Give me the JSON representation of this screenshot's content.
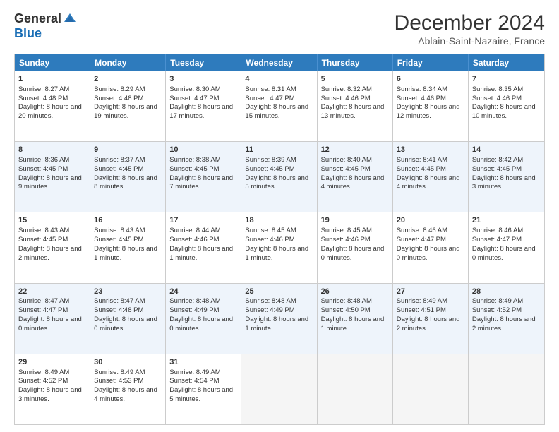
{
  "header": {
    "logo_general": "General",
    "logo_blue": "Blue",
    "month_title": "December 2024",
    "location": "Ablain-Saint-Nazaire, France"
  },
  "weekdays": [
    "Sunday",
    "Monday",
    "Tuesday",
    "Wednesday",
    "Thursday",
    "Friday",
    "Saturday"
  ],
  "rows": [
    {
      "alt": false,
      "cells": [
        {
          "day": "1",
          "info": "Sunrise: 8:27 AM\nSunset: 4:48 PM\nDaylight: 8 hours and 20 minutes."
        },
        {
          "day": "2",
          "info": "Sunrise: 8:29 AM\nSunset: 4:48 PM\nDaylight: 8 hours and 19 minutes."
        },
        {
          "day": "3",
          "info": "Sunrise: 8:30 AM\nSunset: 4:47 PM\nDaylight: 8 hours and 17 minutes."
        },
        {
          "day": "4",
          "info": "Sunrise: 8:31 AM\nSunset: 4:47 PM\nDaylight: 8 hours and 15 minutes."
        },
        {
          "day": "5",
          "info": "Sunrise: 8:32 AM\nSunset: 4:46 PM\nDaylight: 8 hours and 13 minutes."
        },
        {
          "day": "6",
          "info": "Sunrise: 8:34 AM\nSunset: 4:46 PM\nDaylight: 8 hours and 12 minutes."
        },
        {
          "day": "7",
          "info": "Sunrise: 8:35 AM\nSunset: 4:46 PM\nDaylight: 8 hours and 10 minutes."
        }
      ]
    },
    {
      "alt": true,
      "cells": [
        {
          "day": "8",
          "info": "Sunrise: 8:36 AM\nSunset: 4:45 PM\nDaylight: 8 hours and 9 minutes."
        },
        {
          "day": "9",
          "info": "Sunrise: 8:37 AM\nSunset: 4:45 PM\nDaylight: 8 hours and 8 minutes."
        },
        {
          "day": "10",
          "info": "Sunrise: 8:38 AM\nSunset: 4:45 PM\nDaylight: 8 hours and 7 minutes."
        },
        {
          "day": "11",
          "info": "Sunrise: 8:39 AM\nSunset: 4:45 PM\nDaylight: 8 hours and 5 minutes."
        },
        {
          "day": "12",
          "info": "Sunrise: 8:40 AM\nSunset: 4:45 PM\nDaylight: 8 hours and 4 minutes."
        },
        {
          "day": "13",
          "info": "Sunrise: 8:41 AM\nSunset: 4:45 PM\nDaylight: 8 hours and 4 minutes."
        },
        {
          "day": "14",
          "info": "Sunrise: 8:42 AM\nSunset: 4:45 PM\nDaylight: 8 hours and 3 minutes."
        }
      ]
    },
    {
      "alt": false,
      "cells": [
        {
          "day": "15",
          "info": "Sunrise: 8:43 AM\nSunset: 4:45 PM\nDaylight: 8 hours and 2 minutes."
        },
        {
          "day": "16",
          "info": "Sunrise: 8:43 AM\nSunset: 4:45 PM\nDaylight: 8 hours and 1 minute."
        },
        {
          "day": "17",
          "info": "Sunrise: 8:44 AM\nSunset: 4:46 PM\nDaylight: 8 hours and 1 minute."
        },
        {
          "day": "18",
          "info": "Sunrise: 8:45 AM\nSunset: 4:46 PM\nDaylight: 8 hours and 1 minute."
        },
        {
          "day": "19",
          "info": "Sunrise: 8:45 AM\nSunset: 4:46 PM\nDaylight: 8 hours and 0 minutes."
        },
        {
          "day": "20",
          "info": "Sunrise: 8:46 AM\nSunset: 4:47 PM\nDaylight: 8 hours and 0 minutes."
        },
        {
          "day": "21",
          "info": "Sunrise: 8:46 AM\nSunset: 4:47 PM\nDaylight: 8 hours and 0 minutes."
        }
      ]
    },
    {
      "alt": true,
      "cells": [
        {
          "day": "22",
          "info": "Sunrise: 8:47 AM\nSunset: 4:47 PM\nDaylight: 8 hours and 0 minutes."
        },
        {
          "day": "23",
          "info": "Sunrise: 8:47 AM\nSunset: 4:48 PM\nDaylight: 8 hours and 0 minutes."
        },
        {
          "day": "24",
          "info": "Sunrise: 8:48 AM\nSunset: 4:49 PM\nDaylight: 8 hours and 0 minutes."
        },
        {
          "day": "25",
          "info": "Sunrise: 8:48 AM\nSunset: 4:49 PM\nDaylight: 8 hours and 1 minute."
        },
        {
          "day": "26",
          "info": "Sunrise: 8:48 AM\nSunset: 4:50 PM\nDaylight: 8 hours and 1 minute."
        },
        {
          "day": "27",
          "info": "Sunrise: 8:49 AM\nSunset: 4:51 PM\nDaylight: 8 hours and 2 minutes."
        },
        {
          "day": "28",
          "info": "Sunrise: 8:49 AM\nSunset: 4:52 PM\nDaylight: 8 hours and 2 minutes."
        }
      ]
    },
    {
      "alt": false,
      "cells": [
        {
          "day": "29",
          "info": "Sunrise: 8:49 AM\nSunset: 4:52 PM\nDaylight: 8 hours and 3 minutes."
        },
        {
          "day": "30",
          "info": "Sunrise: 8:49 AM\nSunset: 4:53 PM\nDaylight: 8 hours and 4 minutes."
        },
        {
          "day": "31",
          "info": "Sunrise: 8:49 AM\nSunset: 4:54 PM\nDaylight: 8 hours and 5 minutes."
        },
        {
          "day": "",
          "info": ""
        },
        {
          "day": "",
          "info": ""
        },
        {
          "day": "",
          "info": ""
        },
        {
          "day": "",
          "info": ""
        }
      ]
    }
  ]
}
